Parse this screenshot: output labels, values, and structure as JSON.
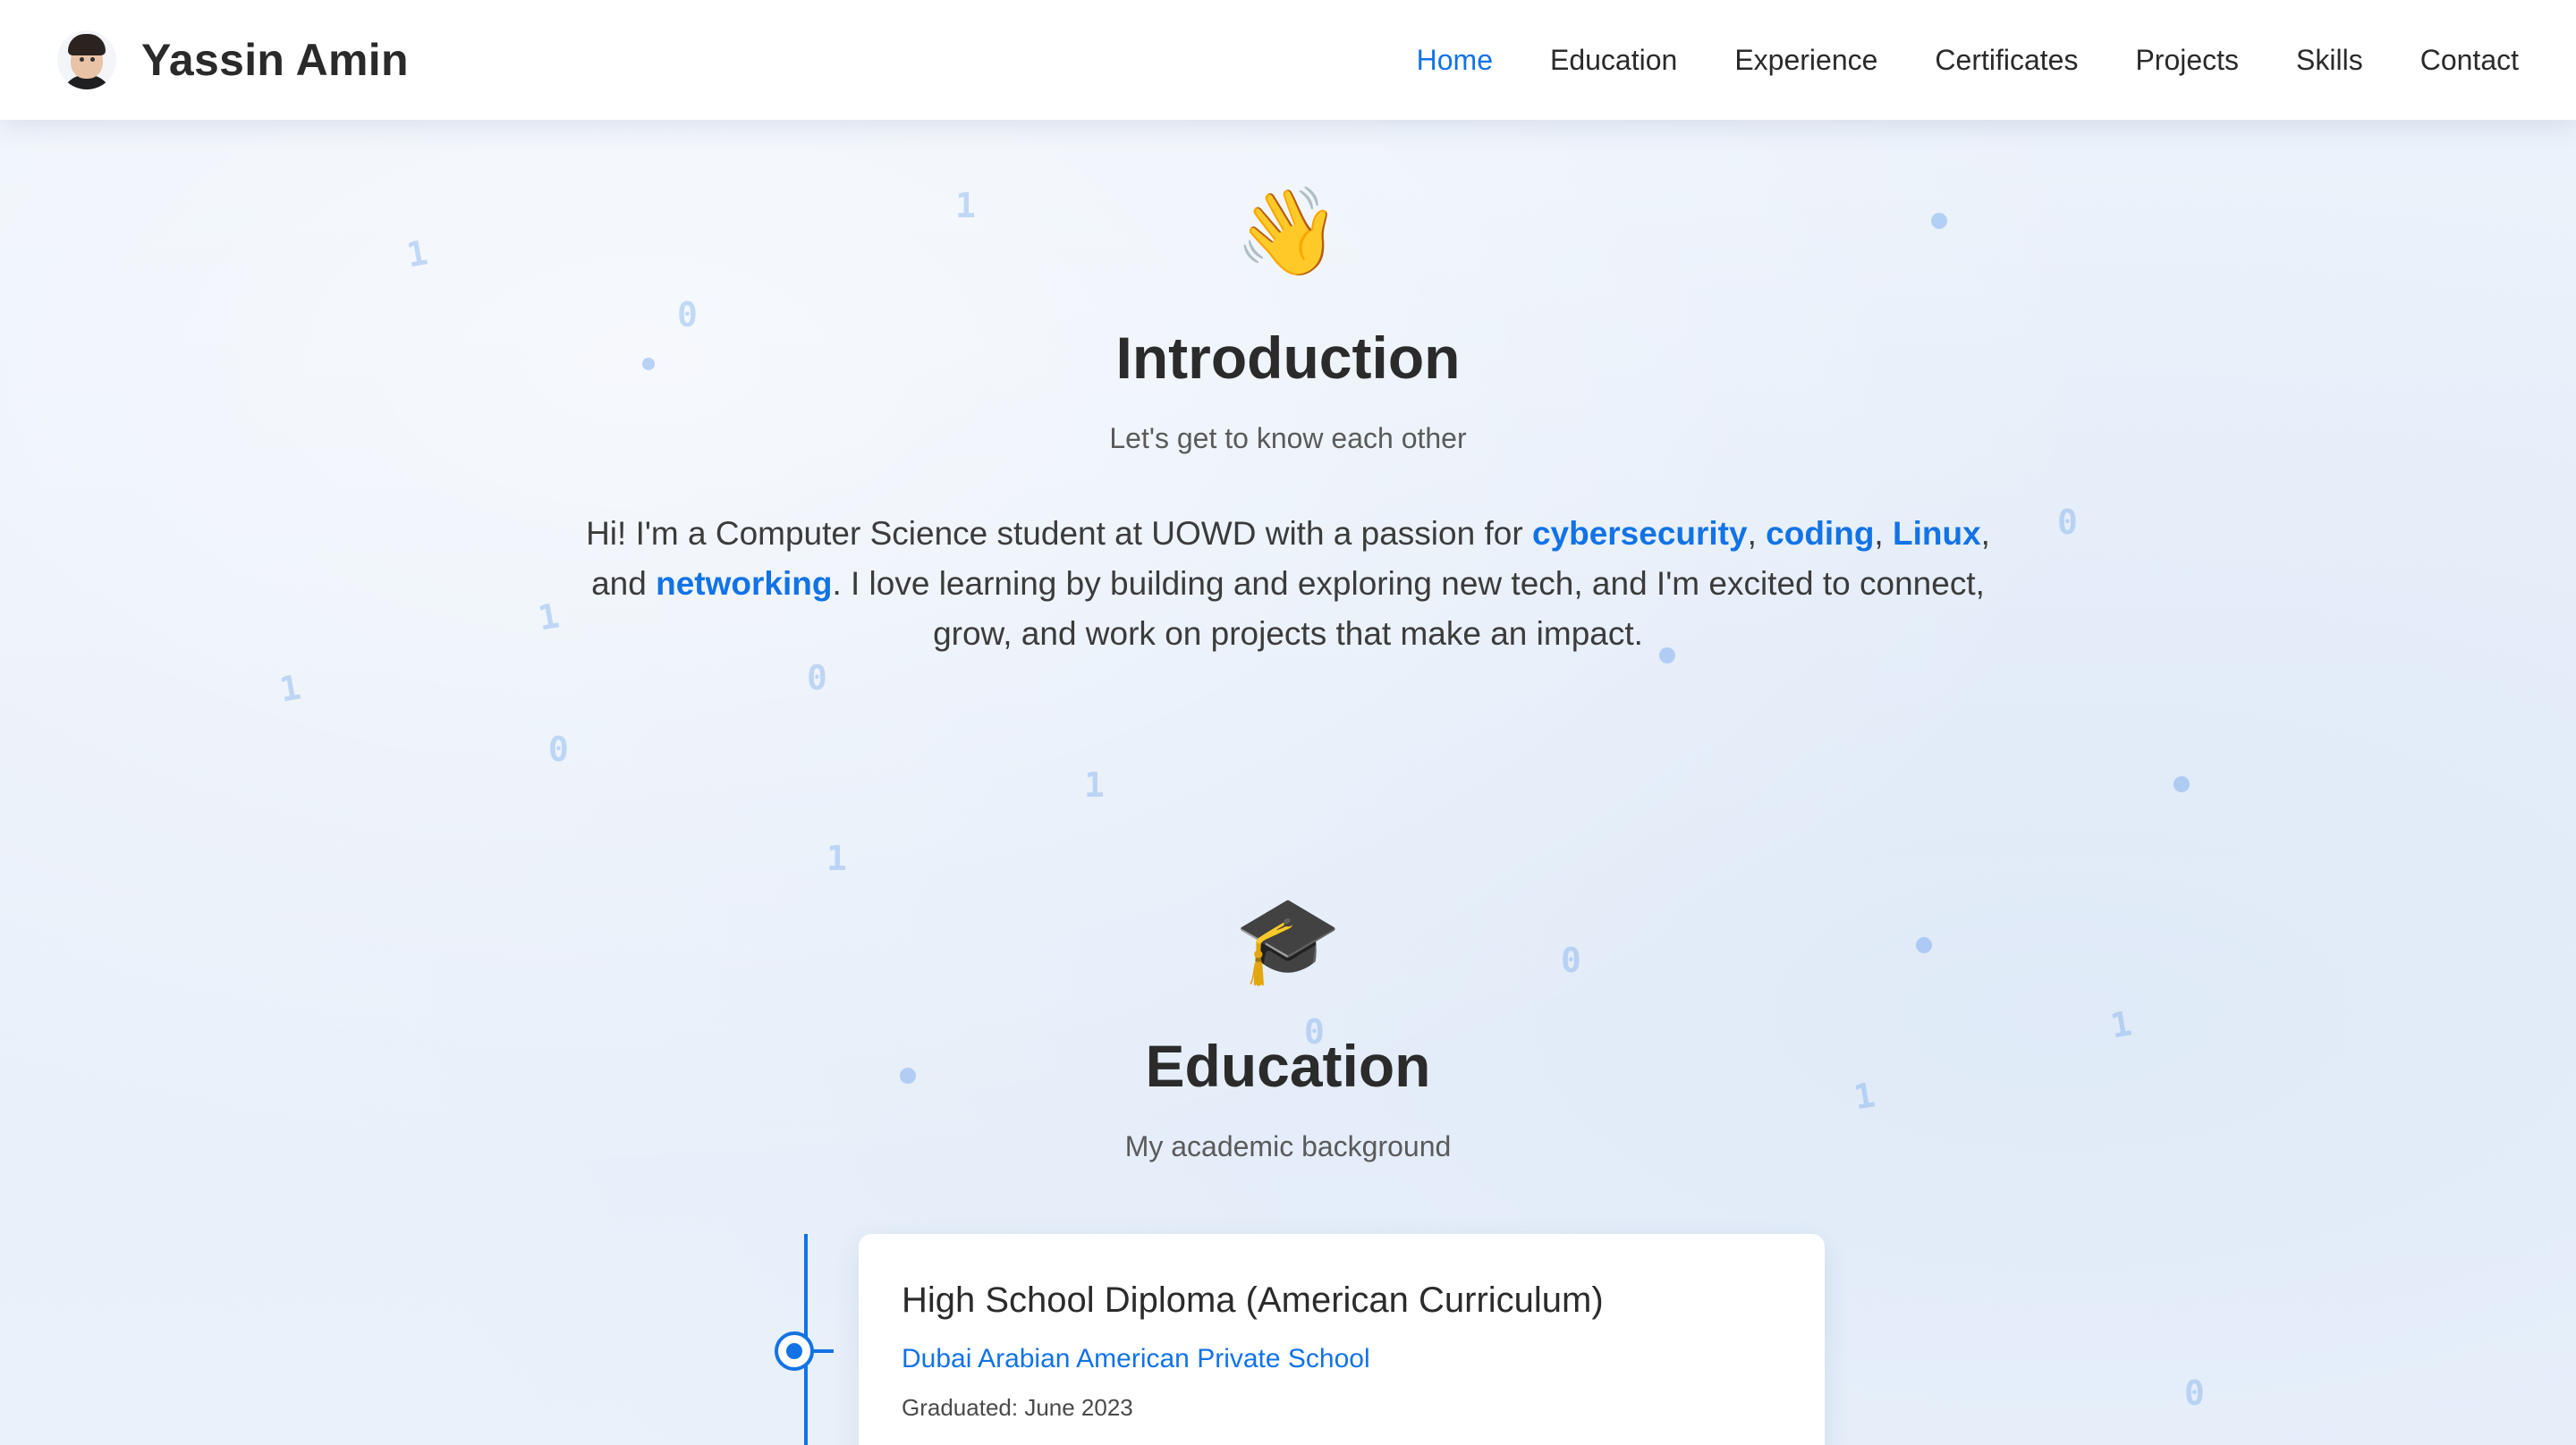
{
  "nav": {
    "brand": "Yassin Amin",
    "items": [
      {
        "label": "Home",
        "active": true
      },
      {
        "label": "Education",
        "active": false
      },
      {
        "label": "Experience",
        "active": false
      },
      {
        "label": "Certificates",
        "active": false
      },
      {
        "label": "Projects",
        "active": false
      },
      {
        "label": "Skills",
        "active": false
      },
      {
        "label": "Contact",
        "active": false
      }
    ]
  },
  "intro": {
    "emoji": "👋",
    "title": "Introduction",
    "subtitle": "Let's get to know each other",
    "text_1": "Hi! I'm a Computer Science student at UOWD with a passion for ",
    "hl_1": "cybersecurity",
    "sep_1": ", ",
    "hl_2": "coding",
    "sep_2": ", ",
    "hl_3": "Linux",
    "sep_3": ", and ",
    "hl_4": "networking",
    "text_2": ". I love learning by building and exploring new tech, and I'm excited to connect, grow, and work on projects that make an impact."
  },
  "education": {
    "emoji": "🎓",
    "title": "Education",
    "subtitle": "My academic background",
    "entries": [
      {
        "title": "High School Diploma (American Curriculum)",
        "school": "Dubai Arabian American Private School",
        "date": "Graduated: June 2023"
      }
    ]
  },
  "background_digits": [
    "1",
    "1",
    "0",
    "0",
    "1",
    "1",
    "0",
    "0",
    "1",
    "1",
    "0",
    "0",
    "1",
    "1",
    "0"
  ],
  "colors": {
    "accent": "#1273e6",
    "text": "#2b2b2b",
    "background": "#e9f0fa"
  }
}
